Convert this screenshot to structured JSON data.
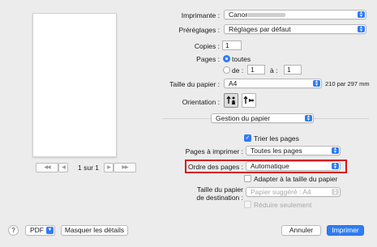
{
  "preview": {
    "page_indicator": "1 sur 1"
  },
  "printer": {
    "label": "Imprimante :",
    "value": "Canon"
  },
  "presets": {
    "label": "Préréglages :",
    "value": "Réglages par défaut"
  },
  "copies": {
    "label": "Copies :",
    "value": "1"
  },
  "pages": {
    "label": "Pages :",
    "all_label": "toutes",
    "from_label": "de :",
    "from_value": "1",
    "to_label": "à :",
    "to_value": "1"
  },
  "paper_size": {
    "label": "Taille du papier :",
    "value": "A4",
    "dims": "210 par 297 mm"
  },
  "orientation": {
    "label": "Orientation :"
  },
  "section": {
    "value": "Gestion du papier"
  },
  "collate": {
    "label": "Trier les pages"
  },
  "pages_to_print": {
    "label": "Pages à imprimer :",
    "value": "Toutes les pages"
  },
  "page_order": {
    "label": "Ordre des pages :",
    "value": "Automatique"
  },
  "scale_to_fit": {
    "label": "Adapter à la taille du papier"
  },
  "dest_paper": {
    "label_line1": "Taille du papier",
    "label_line2": "de destination :",
    "value": "Papier suggéré : A4"
  },
  "scale_down": {
    "label": "Réduire seulement"
  },
  "footer": {
    "help": "?",
    "pdf": "PDF",
    "hide_details": "Masquer les détails",
    "cancel": "Annuler",
    "print": "Imprimer"
  },
  "colors": {
    "accent": "#2f7cf6",
    "highlight": "#d9141a"
  }
}
